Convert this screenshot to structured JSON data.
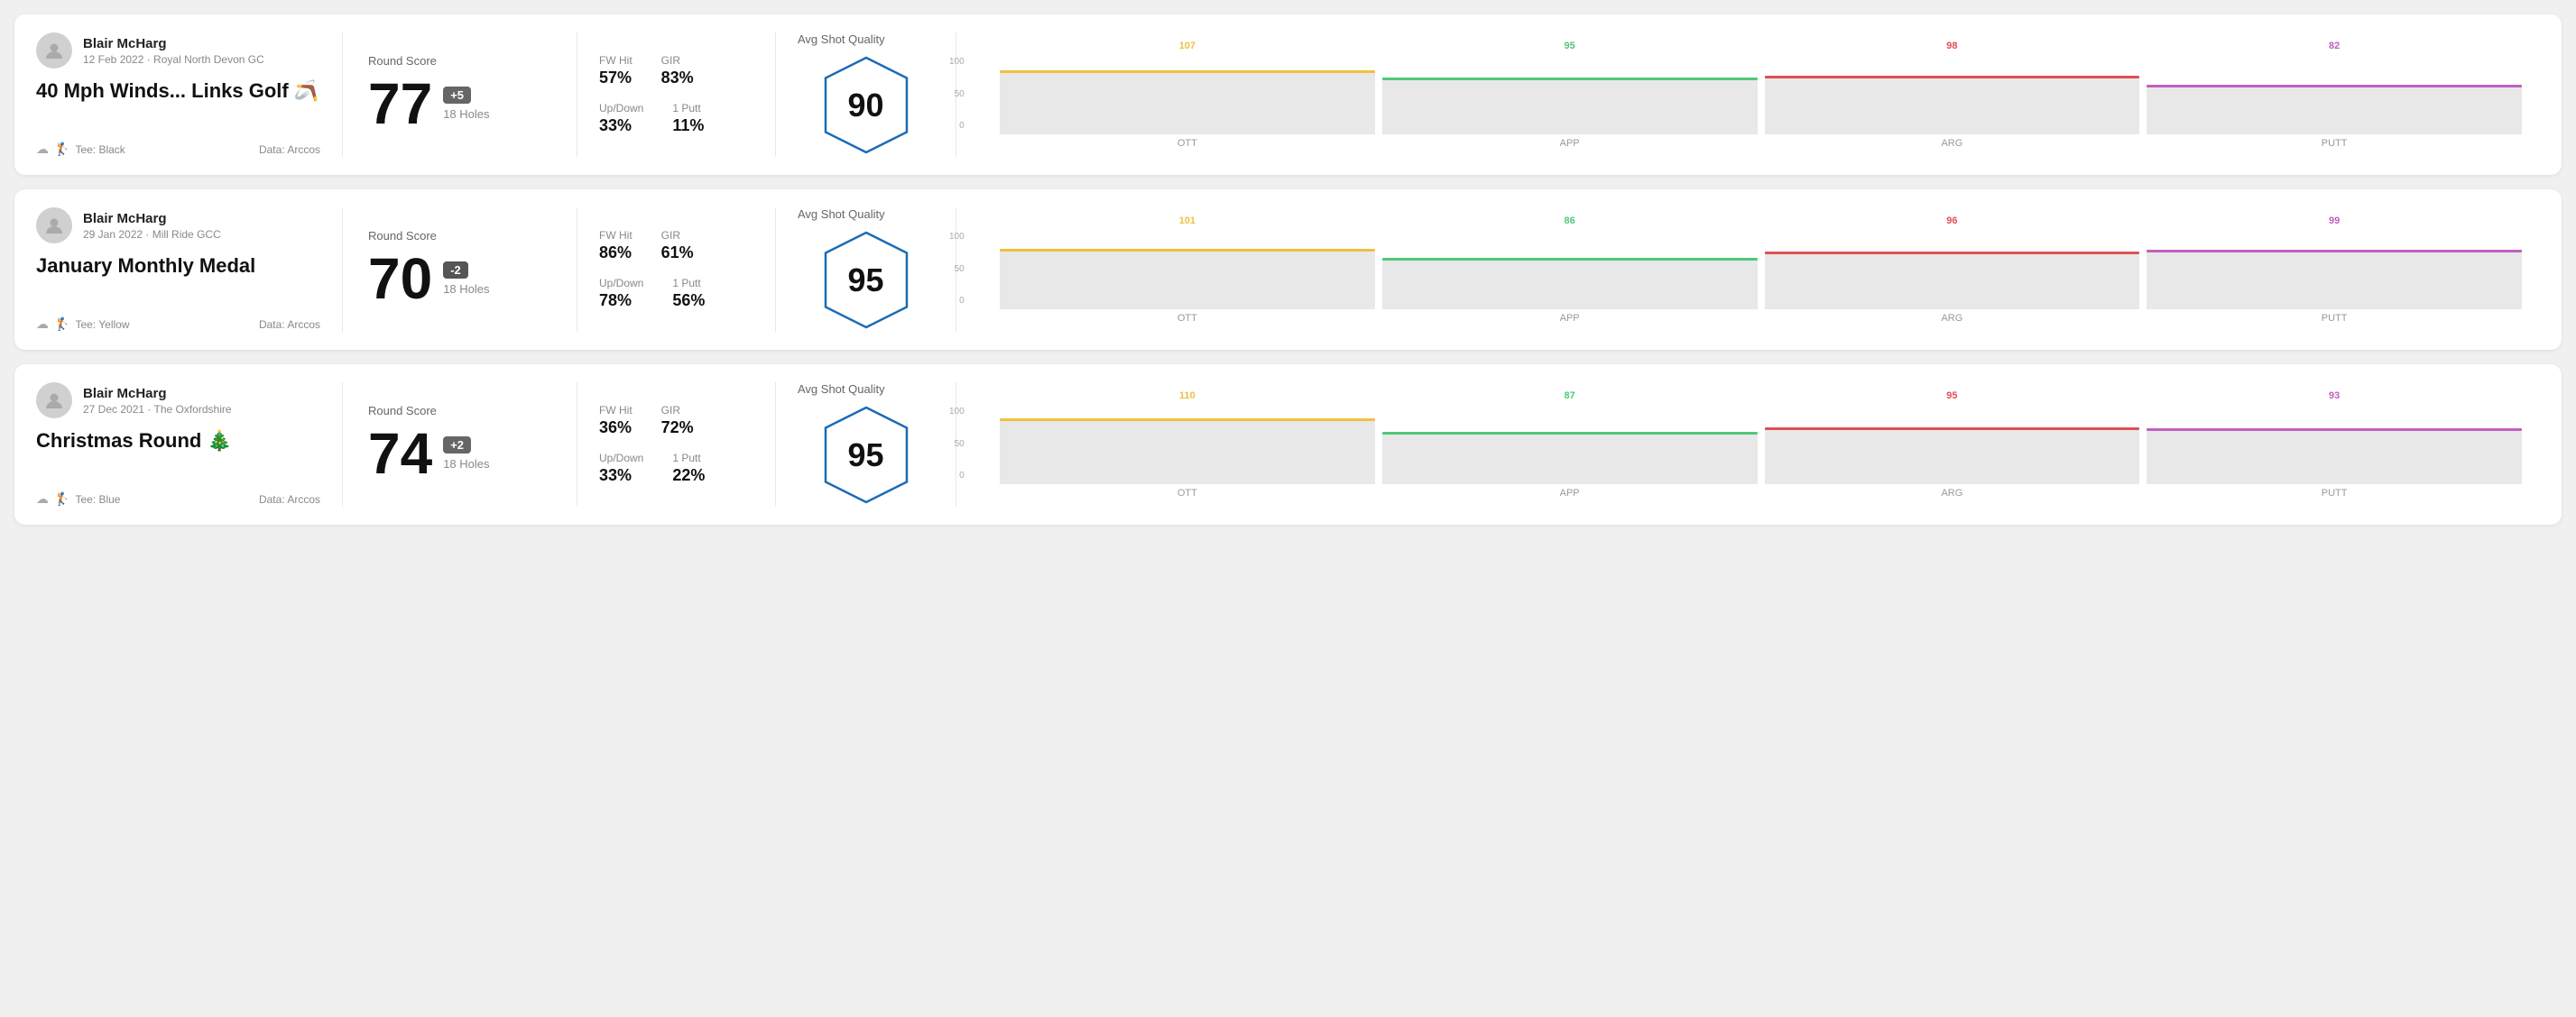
{
  "rounds": [
    {
      "id": "round1",
      "user": {
        "name": "Blair McHarg",
        "date": "12 Feb 2022",
        "course": "Royal North Devon GC",
        "tee": "Black"
      },
      "title": "40 Mph Winds... Links Golf",
      "title_emoji": "🪃",
      "data_source": "Data: Arccos",
      "score": "77",
      "score_diff": "+5",
      "score_diff_type": "plus",
      "holes": "18 Holes",
      "fw_hit": "57%",
      "gir": "83%",
      "up_down": "33%",
      "one_putt": "11%",
      "avg_quality_label": "Avg Shot Quality",
      "quality_score": "90",
      "chart": {
        "bars": [
          {
            "label": "OTT",
            "value": 107,
            "color": "#f0c040"
          },
          {
            "label": "APP",
            "value": 95,
            "color": "#50c878"
          },
          {
            "label": "ARG",
            "value": 98,
            "color": "#e05050"
          },
          {
            "label": "PUTT",
            "value": 82,
            "color": "#c060c0"
          }
        ],
        "max": 120
      }
    },
    {
      "id": "round2",
      "user": {
        "name": "Blair McHarg",
        "date": "29 Jan 2022",
        "course": "Mill Ride GCC",
        "tee": "Yellow"
      },
      "title": "January Monthly Medal",
      "title_emoji": "",
      "data_source": "Data: Arccos",
      "score": "70",
      "score_diff": "-2",
      "score_diff_type": "minus",
      "holes": "18 Holes",
      "fw_hit": "86%",
      "gir": "61%",
      "up_down": "78%",
      "one_putt": "56%",
      "avg_quality_label": "Avg Shot Quality",
      "quality_score": "95",
      "chart": {
        "bars": [
          {
            "label": "OTT",
            "value": 101,
            "color": "#f0c040"
          },
          {
            "label": "APP",
            "value": 86,
            "color": "#50c878"
          },
          {
            "label": "ARG",
            "value": 96,
            "color": "#e05050"
          },
          {
            "label": "PUTT",
            "value": 99,
            "color": "#c060c0"
          }
        ],
        "max": 120
      }
    },
    {
      "id": "round3",
      "user": {
        "name": "Blair McHarg",
        "date": "27 Dec 2021",
        "course": "The Oxfordshire",
        "tee": "Blue"
      },
      "title": "Christmas Round",
      "title_emoji": "🎄",
      "data_source": "Data: Arccos",
      "score": "74",
      "score_diff": "+2",
      "score_diff_type": "plus",
      "holes": "18 Holes",
      "fw_hit": "36%",
      "gir": "72%",
      "up_down": "33%",
      "one_putt": "22%",
      "avg_quality_label": "Avg Shot Quality",
      "quality_score": "95",
      "chart": {
        "bars": [
          {
            "label": "OTT",
            "value": 110,
            "color": "#f0c040"
          },
          {
            "label": "APP",
            "value": 87,
            "color": "#50c878"
          },
          {
            "label": "ARG",
            "value": 95,
            "color": "#e05050"
          },
          {
            "label": "PUTT",
            "value": 93,
            "color": "#c060c0"
          }
        ],
        "max": 120
      }
    }
  ],
  "labels": {
    "round_score": "Round Score",
    "fw_hit": "FW Hit",
    "gir": "GIR",
    "up_down": "Up/Down",
    "one_putt": "1 Putt",
    "avg_shot_quality": "Avg Shot Quality",
    "ott": "OTT",
    "app": "APP",
    "arg": "ARG",
    "putt": "PUTT"
  }
}
